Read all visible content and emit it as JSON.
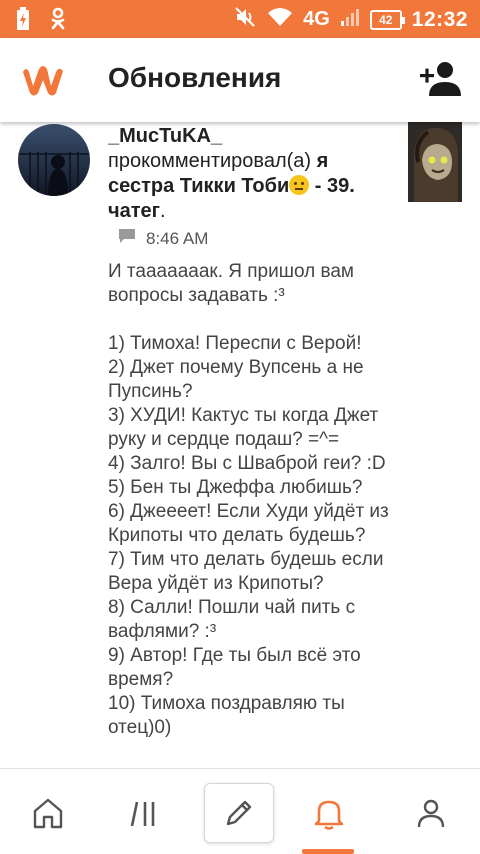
{
  "status_bar": {
    "network": "4G",
    "battery": "42",
    "time": "12:32",
    "icons": [
      "battery-charging-icon",
      "odnoklassniki-icon",
      "mute-icon",
      "wifi-icon",
      "signal-icon"
    ]
  },
  "app_bar": {
    "title": "Обновления",
    "logo_icon": "wattpad-logo",
    "action_icon": "add-user-icon"
  },
  "notification": {
    "username": "_MucTuKA_",
    "action": "прокомментировал(а)",
    "story": "я сестра Тикки Тоби",
    "story_suffix": " - 39. чатег",
    "period": ".",
    "time": "8:46 AM",
    "comment": "И таааааaак. Я пришол вам вопросы задавать :³\n\n1) Тимоха! Переспи с Верой!\n2) Джет почему Вупсень а не Пупсинь?\n3) ХУДИ! Кактус ты когда Джет руку и сердце подаш? =^=\n4) Залго! Вы с Шваброй геи? :D\n5) Бен ты Джеффа любишь?\n6) Джеееет! Если Худи уйдёт из Крипоты что делать будешь?\n7) Тим что делать будешь если Вера уйдёт из Крипоты?\n8) Салли! Пошли чай пить с вафлями? :³\n9) Автор! Где ты был всё это время?\n10) Тимоха поздравляю ты отец)0)"
  },
  "bottom_nav": {
    "items": [
      "home-icon",
      "library-icon",
      "write-icon",
      "notifications-icon",
      "profile-icon"
    ],
    "active": "notifications-icon"
  },
  "colors": {
    "accent": "#f2773a",
    "text_dark": "#222222",
    "text_body": "#444444",
    "icon_gray": "#555555"
  }
}
